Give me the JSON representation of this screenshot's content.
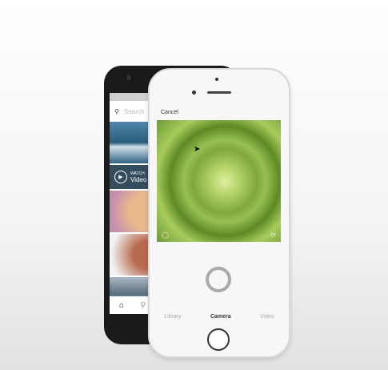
{
  "back_phone": {
    "search_placeholder": "Search",
    "watch_label": "WATCH",
    "video_label": "Video"
  },
  "front_phone": {
    "cancel_label": "Cancel",
    "tabs": [
      {
        "label": "Library"
      },
      {
        "label": "Camera"
      },
      {
        "label": "Video"
      }
    ],
    "active_tab": "Camera"
  }
}
